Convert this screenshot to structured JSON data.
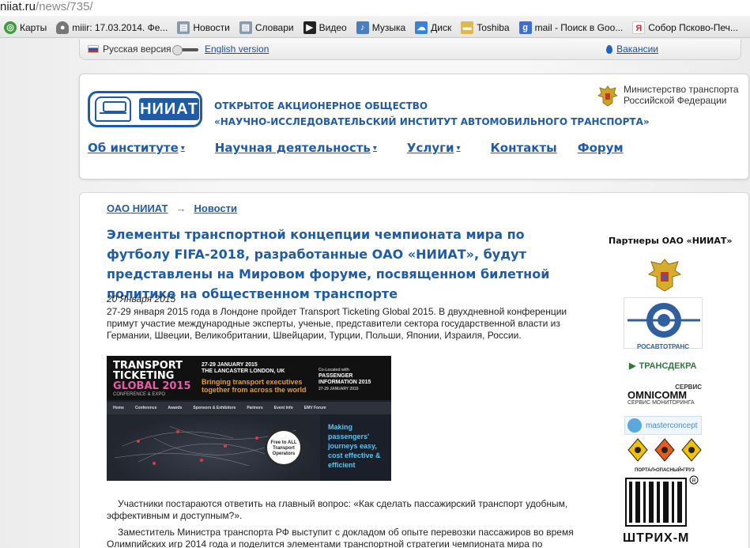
{
  "browser": {
    "address_host": "niiat.ru",
    "address_path": "/news/735/"
  },
  "bookmarks": [
    {
      "label": "Карты",
      "icon": "maps-icon",
      "color": "#3a9d3a"
    },
    {
      "label": "miiir: 17.03.2014. Фе...",
      "icon": "user-icon",
      "color": "#666666"
    },
    {
      "label": "Новости",
      "icon": "page-icon",
      "color": "#8899aa"
    },
    {
      "label": "Словари",
      "icon": "page-icon",
      "color": "#8899aa"
    },
    {
      "label": "Видео",
      "icon": "play-icon",
      "color": "#222222"
    },
    {
      "label": "Музыка",
      "icon": "sound-icon",
      "color": "#4a7ec4"
    },
    {
      "label": "Диск",
      "icon": "disk-icon",
      "color": "#3b82d6"
    },
    {
      "label": "Toshiba",
      "icon": "folder-icon",
      "color": "#e2b84a"
    },
    {
      "label": "mail - Поиск в Goo...",
      "icon": "google-icon",
      "color": "#3b6fd6"
    },
    {
      "label": "Собор Псково-Печ...",
      "icon": "yandex-icon",
      "color": "#d32f2f"
    }
  ],
  "langbar": {
    "ru": "Русская версия",
    "en": "English version",
    "vacancies": "Вакансии"
  },
  "header": {
    "logo_text": "НИИАТ",
    "org_line1": "ОТКРЫТОЕ АКЦИОНЕРНОЕ ОБЩЕСТВО",
    "org_line2": "«НАУЧНО-ИССЛЕДОВАТЕЛЬСКИЙ ИНСТИТУТ АВТОМОБИЛЬНОГО ТРАНСПОРТА»",
    "ministry_line1": "Министерство транспорта",
    "ministry_line2": "Российской Федерации"
  },
  "nav": [
    {
      "label": "Об институте",
      "dropdown": true
    },
    {
      "label": "Научная деятельность",
      "dropdown": true
    },
    {
      "label": "Услуги",
      "dropdown": true
    },
    {
      "label": "Контакты",
      "dropdown": false
    },
    {
      "label": "Форум",
      "dropdown": false
    }
  ],
  "breadcrumbs": {
    "root": "ОАО НИИАТ",
    "separator": "→",
    "current": "Новости"
  },
  "article": {
    "title": "Элементы транспортной концепции чемпионата мира по футболу FIFA-2018, разработанные ОАО «НИИАТ», будут представлены на Мировом форуме, посвященном билетной политике на общественном транспорте",
    "date": "20 Января 2015",
    "lead": "27-29 января 2015 года в Лондоне пройдет Transport Ticketing Global 2015. В двухдневной конференции примут участие международные эксперты, ученые, представители сектора государственной власти из Германии, Швеции, Великобритании, Швейцарии, Турции, Польши, Японии, Израиля, России.",
    "para1": "Участники постараются ответить на главный вопрос: «Как сделать пассажирский транспорт удобным, эффективным и доступным?».",
    "para2": "Заместитель Министра транспорта РФ выступит с докладом об опыте перевозки пассажиров во время Олимпийских игр 2014 года и поделится элементами транспортной стратегии чемпионата мира по"
  },
  "banner": {
    "tt1": "TRANSPORT",
    "tt2": "TICKETING",
    "tt3": "GLOBAL 2015",
    "conf": "CONFERENCE & EXPO",
    "dates": "27-29 JANUARY 2015",
    "venue": "THE LANCASTER LONDON, UK",
    "bring": "Bringing transport executives together from across the world",
    "colocated": "Co-Located with",
    "pass1": "PASSENGER",
    "pass2": "INFORMATION 2015",
    "pass3": "27-29 JANUARY 2015",
    "menu": [
      "Home",
      "Conference",
      "Awards",
      "Sponsors & Exhibitors",
      "Partners",
      "Event Info",
      "EMV Forum"
    ],
    "free": "Free to ALL Transport Operators",
    "making": "Making passengers' journeys easy, cost effective & efficient"
  },
  "partners": {
    "title": "Партнеры ОАО «НИИАТ»",
    "items": [
      {
        "name": "ministry-emblem"
      },
      {
        "name": "rosavtotrans",
        "label": "РОСАВТОТРАНС"
      },
      {
        "name": "transdekra",
        "label": "ТРАНСДЕКРА"
      },
      {
        "name": "omnicomm",
        "label1": "СЕРВИС",
        "label2": "OMNICOMM",
        "label3": "СЕРВИС МОНИТОРИНГА"
      },
      {
        "name": "masterconcept",
        "label": "masterconcept"
      },
      {
        "name": "portal-dangerous-cargo",
        "label": "ПОРТАЛ•ОПАСНЫЙ•ГРУЗ"
      },
      {
        "name": "shtrih-m",
        "label": "ШТРИХ-М"
      }
    ]
  },
  "colors": {
    "brand_blue": "#1f5ca8",
    "link_blue": "#1c4f9c"
  }
}
